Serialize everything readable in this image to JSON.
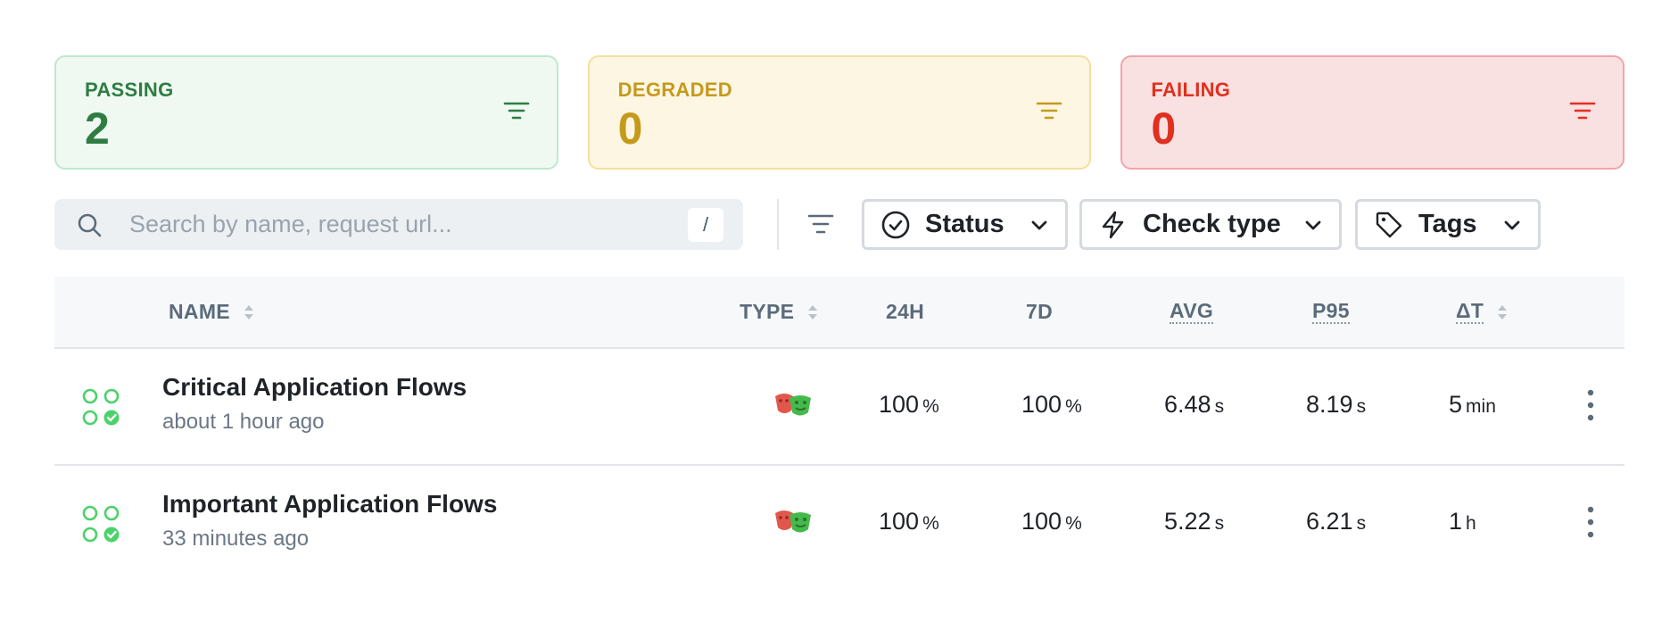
{
  "summary": {
    "passing": {
      "label": "PASSING",
      "count": "2"
    },
    "degraded": {
      "label": "DEGRADED",
      "count": "0"
    },
    "failing": {
      "label": "FAILING",
      "count": "0"
    }
  },
  "toolbar": {
    "search_placeholder": "Search by name, request url...",
    "search_shortcut": "/",
    "status_label": "Status",
    "check_type_label": "Check type",
    "tags_label": "Tags"
  },
  "table": {
    "headers": {
      "name": "NAME",
      "type": "TYPE",
      "h24": "24H",
      "d7": "7D",
      "avg": "AVG",
      "p95": "P95",
      "dt": "ΔT"
    },
    "rows": [
      {
        "name": "Critical Application Flows",
        "time": "about 1 hour ago",
        "type_icon": "playwright-icon",
        "h24": "100",
        "h24_unit": "%",
        "d7": "100",
        "d7_unit": "%",
        "avg": "6.48",
        "avg_unit": "s",
        "p95": "8.19",
        "p95_unit": "s",
        "dt": "5",
        "dt_unit": "min"
      },
      {
        "name": "Important Application Flows",
        "time": "33 minutes ago",
        "type_icon": "playwright-icon",
        "h24": "100",
        "h24_unit": "%",
        "d7": "100",
        "d7_unit": "%",
        "avg": "5.22",
        "avg_unit": "s",
        "p95": "6.21",
        "p95_unit": "s",
        "dt": "1",
        "dt_unit": "h"
      }
    ]
  },
  "colors": {
    "passing": "#2f7d43",
    "degraded": "#c59a1c",
    "failing": "#e0301e",
    "status_dot": "#4cd26b"
  }
}
